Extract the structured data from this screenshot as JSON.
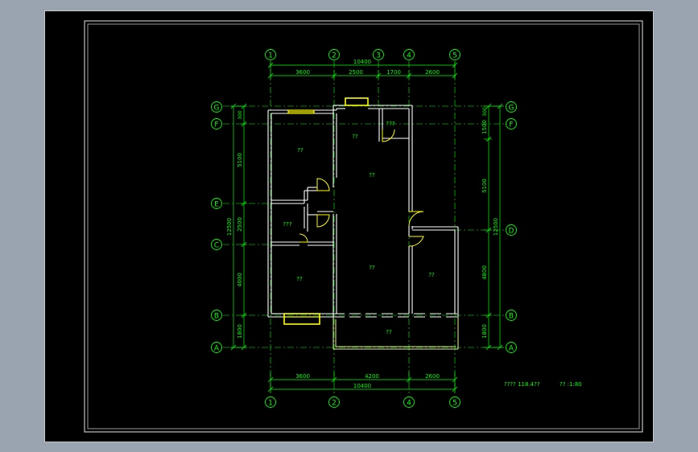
{
  "colors": {
    "background": "#000000",
    "axis": "#00ff00",
    "wall": "#ffffff",
    "window": "#ffff00",
    "frame": "#c0c0c0",
    "text": "#00ff00"
  },
  "axes": {
    "top": [
      "1",
      "2",
      "3",
      "4",
      "5"
    ],
    "bottom": [
      "1",
      "2",
      "4",
      "5"
    ],
    "left": [
      "G",
      "F",
      "E",
      "C",
      "B",
      "A"
    ],
    "right": [
      "G",
      "F",
      "D",
      "B",
      "A"
    ]
  },
  "dimensions": {
    "top_total": "10400",
    "top_segments": [
      "3600",
      "2500",
      "1700",
      "2600"
    ],
    "bottom_segments": [
      "3600",
      "4200",
      "2600"
    ],
    "bottom_total": "10400",
    "left_outer": "12500",
    "left_segments": [
      "5100",
      "2500",
      "4000",
      "1800"
    ],
    "left_top": "300",
    "right_outer": "12500",
    "right_segments": [
      "1500",
      "5100",
      "4800",
      "1800"
    ],
    "right_top": "300"
  },
  "rooms": {
    "bedroom_nw": "??",
    "kitchen": "??",
    "toilet_ne": "???",
    "corridor": "??",
    "toilet_w": "???",
    "living": "??",
    "bedroom_sw": "??",
    "bedroom_e": "??",
    "balcony": "??"
  },
  "title_block": {
    "name": "????  118.4??",
    "scale": "?? :1:80"
  }
}
